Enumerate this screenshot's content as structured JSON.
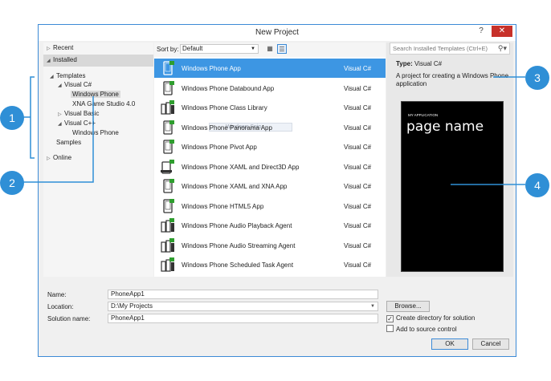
{
  "window": {
    "title": "New Project",
    "help": "?",
    "close": "✕"
  },
  "tree": {
    "recent": "Recent",
    "installed": "Installed",
    "templates": "Templates",
    "visual_csharp": "Visual C#",
    "windows_phone": "Windows Phone",
    "xna": "XNA Game Studio 4.0",
    "visual_basic": "Visual Basic",
    "visual_cpp": "Visual C++",
    "cpp_windows_phone": "Windows Phone",
    "samples": "Samples",
    "online": "Online"
  },
  "sortbar": {
    "label": "Sort by:",
    "value": "Default"
  },
  "drag_ghost": "Windows Snip",
  "templates": [
    {
      "name": "Windows Phone App",
      "lang": "Visual C#",
      "icon": "phone-icon"
    },
    {
      "name": "Windows Phone Databound App",
      "lang": "Visual C#",
      "icon": "phone-icon"
    },
    {
      "name": "Windows Phone Class Library",
      "lang": "Visual C#",
      "icon": "library-icon"
    },
    {
      "name": "Windows Phone Panorama App",
      "lang": "Visual C#",
      "icon": "phone-icon"
    },
    {
      "name": "Windows Phone Pivot App",
      "lang": "Visual C#",
      "icon": "phone-icon"
    },
    {
      "name": "Windows Phone XAML and Direct3D App",
      "lang": "Visual C#",
      "icon": "phone-landscape-icon"
    },
    {
      "name": "Windows Phone XAML and XNA App",
      "lang": "Visual C#",
      "icon": "phone-icon"
    },
    {
      "name": "Windows Phone HTML5 App",
      "lang": "Visual C#",
      "icon": "phone-icon"
    },
    {
      "name": "Windows Phone Audio Playback Agent",
      "lang": "Visual C#",
      "icon": "library-icon"
    },
    {
      "name": "Windows Phone Audio Streaming Agent",
      "lang": "Visual C#",
      "icon": "library-icon"
    },
    {
      "name": "Windows Phone Scheduled Task Agent",
      "lang": "Visual C#",
      "icon": "library-icon"
    }
  ],
  "details": {
    "search_placeholder": "Search Installed Templates (Ctrl+E)",
    "type_label": "Type:",
    "type_value": "Visual C#",
    "description": "A project for creating a Windows Phone application",
    "preview_app": "MY APPLICATION",
    "preview_page": "page name"
  },
  "form": {
    "name_label": "Name:",
    "name_value": "PhoneApp1",
    "location_label": "Location:",
    "location_value": "D:\\My Projects",
    "solution_label": "Solution name:",
    "solution_value": "PhoneApp1",
    "browse": "Browse...",
    "create_dir": "Create directory for solution",
    "create_dir_checked": true,
    "source_control": "Add to source control",
    "source_control_checked": false,
    "ok": "OK",
    "cancel": "Cancel"
  },
  "callouts": [
    "1",
    "2",
    "3",
    "4"
  ],
  "colors": {
    "accent": "#3d96e3",
    "callout": "#2f8fd6",
    "close": "#c7312a",
    "icon_green": "#2e9e2e"
  }
}
